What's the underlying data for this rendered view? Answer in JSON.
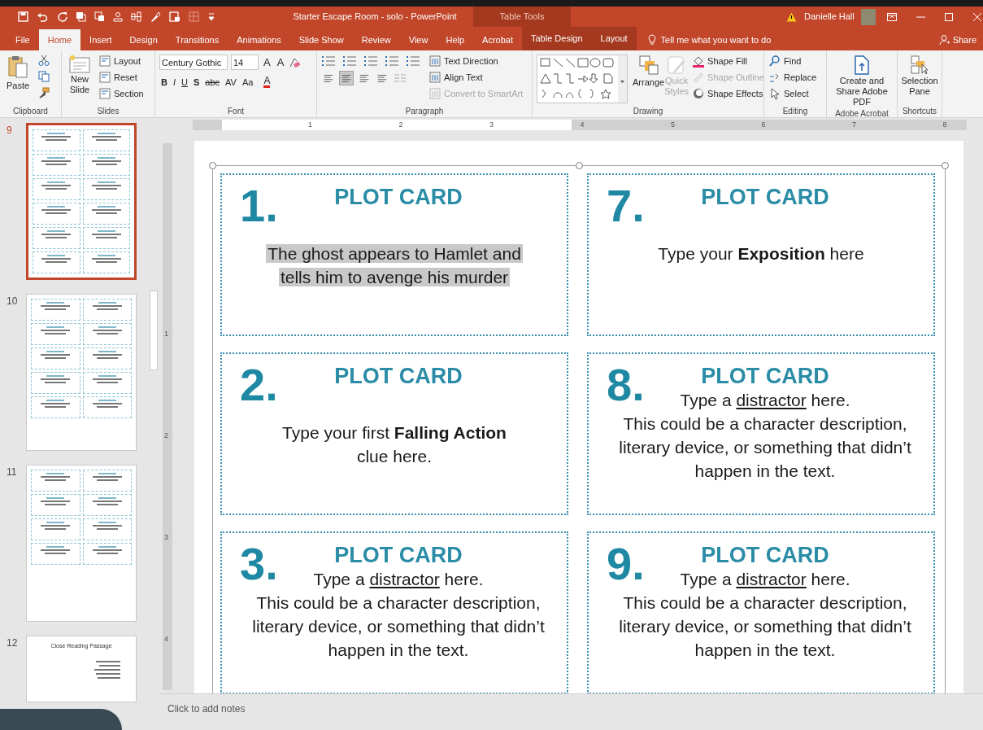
{
  "window": {
    "title": "Starter Escape Room - solo  -  PowerPoint",
    "context_group": "Table Tools",
    "user": "Danielle Hall"
  },
  "tabs": [
    {
      "label": "File",
      "selected": false,
      "contextual": false
    },
    {
      "label": "Home",
      "selected": true,
      "contextual": false
    },
    {
      "label": "Insert",
      "selected": false,
      "contextual": false
    },
    {
      "label": "Design",
      "selected": false,
      "contextual": false
    },
    {
      "label": "Transitions",
      "selected": false,
      "contextual": false
    },
    {
      "label": "Animations",
      "selected": false,
      "contextual": false
    },
    {
      "label": "Slide Show",
      "selected": false,
      "contextual": false
    },
    {
      "label": "Review",
      "selected": false,
      "contextual": false
    },
    {
      "label": "View",
      "selected": false,
      "contextual": false
    },
    {
      "label": "Help",
      "selected": false,
      "contextual": false
    },
    {
      "label": "Acrobat",
      "selected": false,
      "contextual": false
    },
    {
      "label": "Table Design",
      "selected": false,
      "contextual": true
    },
    {
      "label": "Layout",
      "selected": false,
      "contextual": true
    }
  ],
  "tell_me": "Tell me what you want to do",
  "share": "Share",
  "ribbon": {
    "clipboard": {
      "label": "Clipboard",
      "paste": "Paste"
    },
    "slides": {
      "label": "Slides",
      "new_slide": "New Slide",
      "commands": [
        "Layout",
        "Reset",
        "Section"
      ]
    },
    "font": {
      "label": "Font",
      "font_name": "Century Gothic",
      "font_size": "14",
      "size_buttons": [
        "A",
        "A"
      ],
      "format_buttons": [
        "B",
        "I",
        "U",
        "S",
        "abc",
        "AV",
        "Aa"
      ],
      "color_button": "A"
    },
    "paragraph": {
      "label": "Paragraph",
      "commands": [
        {
          "label": "Text Direction",
          "disabled": false
        },
        {
          "label": "Align Text",
          "disabled": false
        },
        {
          "label": "Convert to SmartArt",
          "disabled": true
        }
      ],
      "align_buttons": [
        {
          "selected": false
        },
        {
          "selected": true
        },
        {
          "selected": false
        },
        {
          "selected": false
        }
      ]
    },
    "drawing": {
      "label": "Drawing",
      "arrange": "Arrange",
      "quick_styles": {
        "label": "Quick Styles",
        "disabled": true
      },
      "commands": [
        {
          "label": "Shape Fill",
          "disabled": false
        },
        {
          "label": "Shape Outline",
          "disabled": true
        },
        {
          "label": "Shape Effects",
          "disabled": false
        }
      ]
    },
    "editing": {
      "label": "Editing",
      "commands": [
        "Find",
        "Replace",
        "Select"
      ]
    },
    "acrobat": {
      "label": "Adobe Acrobat",
      "button": "Create and Share Adobe PDF"
    },
    "shortcuts": {
      "label": "Shortcuts",
      "button": "Selection Pane"
    }
  },
  "slides_pane": [
    {
      "number": "9",
      "selected": true,
      "kind": "plot"
    },
    {
      "number": "10",
      "selected": false,
      "kind": "character"
    },
    {
      "number": "11",
      "selected": false,
      "kind": "character_short"
    },
    {
      "number": "12",
      "selected": false,
      "kind": "passage",
      "title": "Close Reading Passage"
    }
  ],
  "ruler_h": [
    "1",
    "2",
    "3",
    "4",
    "5",
    "6",
    "7",
    "8"
  ],
  "ruler_v": [
    "1",
    "2",
    "3",
    "4"
  ],
  "cards": [
    {
      "number": "1.",
      "heading": "PLOT CARD",
      "kind": "clue",
      "highlighted": true,
      "lines": [
        [
          {
            "text": "The ghost appears to Hamlet and",
            "kind": "plain"
          }
        ],
        [
          {
            "text": "tells him to avenge his murder",
            "kind": "plain"
          }
        ]
      ]
    },
    {
      "number": "7.",
      "heading": "PLOT CARD",
      "kind": "clue",
      "highlighted": false,
      "lines": [
        [
          {
            "text": "Type your ",
            "kind": "plain"
          },
          {
            "text": "Exposition",
            "kind": "bold"
          },
          {
            "text": " here",
            "kind": "plain"
          }
        ]
      ]
    },
    {
      "number": "2.",
      "heading": "PLOT CARD",
      "kind": "clue",
      "highlighted": false,
      "lines": [
        [
          {
            "text": "Type your first ",
            "kind": "plain"
          },
          {
            "text": "Falling Action",
            "kind": "bold"
          }
        ],
        [
          {
            "text": "clue here.",
            "kind": "plain"
          }
        ]
      ]
    },
    {
      "number": "8.",
      "heading": "PLOT CARD",
      "kind": "distractor",
      "highlighted": false,
      "lines": [
        [
          {
            "text": "Type a ",
            "kind": "plain"
          },
          {
            "text": "distractor",
            "kind": "underline"
          },
          {
            "text": " here.",
            "kind": "plain"
          }
        ],
        [
          {
            "text": "This could be a character description,",
            "kind": "plain"
          }
        ],
        [
          {
            "text": "literary device, or something that didn’t",
            "kind": "plain"
          }
        ],
        [
          {
            "text": "happen in the text.",
            "kind": "plain"
          }
        ]
      ]
    },
    {
      "number": "3.",
      "heading": "PLOT CARD",
      "kind": "distractor",
      "highlighted": false,
      "lines": [
        [
          {
            "text": "Type a ",
            "kind": "plain"
          },
          {
            "text": "distractor",
            "kind": "underline"
          },
          {
            "text": " here.",
            "kind": "plain"
          }
        ],
        [
          {
            "text": "This could be a character description,",
            "kind": "plain"
          }
        ],
        [
          {
            "text": "literary device, or something that didn’t",
            "kind": "plain"
          }
        ],
        [
          {
            "text": "happen in the text.",
            "kind": "plain"
          }
        ]
      ]
    },
    {
      "number": "9.",
      "heading": "PLOT CARD",
      "kind": "distractor",
      "highlighted": false,
      "lines": [
        [
          {
            "text": "Type a ",
            "kind": "plain"
          },
          {
            "text": "distractor",
            "kind": "underline"
          },
          {
            "text": " here.",
            "kind": "plain"
          }
        ],
        [
          {
            "text": "This could be a character description,",
            "kind": "plain"
          }
        ],
        [
          {
            "text": "literary device, or something that didn’t",
            "kind": "plain"
          }
        ],
        [
          {
            "text": "happen in the text.",
            "kind": "plain"
          }
        ]
      ]
    }
  ],
  "notes_placeholder": "Click to add notes"
}
